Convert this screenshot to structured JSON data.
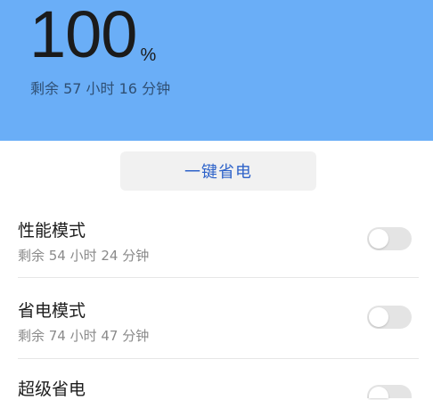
{
  "battery": {
    "level": "100",
    "unit": "%",
    "remaining": "剩余 57 小时 16 分钟"
  },
  "one_click_label": "一键省电",
  "modes": [
    {
      "title": "性能模式",
      "subtitle": "剩余 54 小时 24 分钟",
      "enabled": false
    },
    {
      "title": "省电模式",
      "subtitle": "剩余 74 小时 47 分钟",
      "enabled": false
    },
    {
      "title": "超级省电",
      "subtitle": "",
      "enabled": false
    }
  ],
  "colors": {
    "header_bg": "#6aaef7",
    "accent_text": "#2d62c9",
    "toggle_off": "#e4e4e4"
  }
}
